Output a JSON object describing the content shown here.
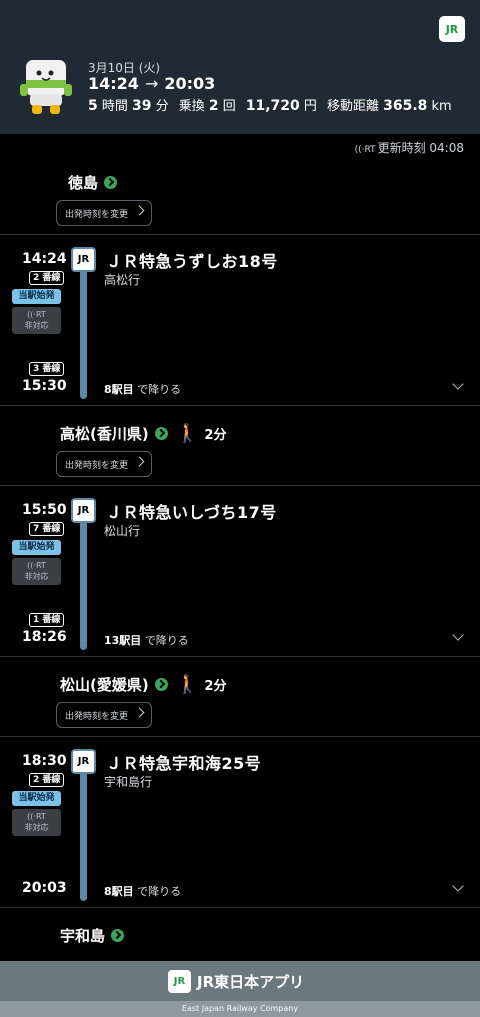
{
  "header": {
    "app_logo": "JR",
    "date": "3月10日 (火)",
    "depart": "14:24",
    "arrow": "→",
    "arrive": "20:03",
    "duration_h": "5",
    "duration_h_unit": "時間",
    "duration_m": "39",
    "duration_m_unit": "分",
    "transfer_label": "乗換",
    "transfers": "2",
    "transfer_unit": "回",
    "fare": "11,720",
    "fare_unit": "円",
    "distance_label": "移動距離",
    "distance": "365.8",
    "distance_unit": "km"
  },
  "realtime": {
    "icon": "((·RT",
    "label": "更新時刻",
    "time": "04:08"
  },
  "stations": {
    "s1": "徳島",
    "s2": "高松(香川県)",
    "s3": "松山(愛媛県)",
    "s4": "宇和島"
  },
  "change_departure_label": "出発時刻を変更",
  "walks": {
    "w1": "2分",
    "w2": "2分"
  },
  "legs": [
    {
      "dep_time": "14:24",
      "dep_track": "2 番線",
      "origin_badge": "当駅始発",
      "rt_badge_1": "((·RT",
      "rt_badge_2": "非対応",
      "logo": "JR",
      "train_name": "ＪＲ特急うずしお18号",
      "destination": "高松行",
      "arr_track": "3 番線",
      "arr_time": "15:30",
      "stops_count": "8駅目",
      "stops_suffix": "で降りる"
    },
    {
      "dep_time": "15:50",
      "dep_track": "7 番線",
      "origin_badge": "当駅始発",
      "rt_badge_1": "((·RT",
      "rt_badge_2": "非対応",
      "logo": "JR",
      "train_name": "ＪＲ特急いしづち17号",
      "destination": "松山行",
      "arr_track": "1 番線",
      "arr_time": "18:26",
      "stops_count": "13駅目",
      "stops_suffix": "で降りる"
    },
    {
      "dep_time": "18:30",
      "dep_track": "2 番線",
      "origin_badge": "当駅始発",
      "rt_badge_1": "((·RT",
      "rt_badge_2": "非対応",
      "logo": "JR",
      "train_name": "ＪＲ特急宇和海25号",
      "destination": "宇和島行",
      "arr_track": "",
      "arr_time": "20:03",
      "stops_count": "8駅目",
      "stops_suffix": "で降りる"
    }
  ],
  "footer": {
    "logo": "JR",
    "title": "JR東日本アプリ",
    "subtitle": "East Japan Railway Company"
  },
  "colors": {
    "header_bg": "#1f2a35",
    "accent_green": "#3ba55c",
    "line_blue": "#5a8aa8",
    "origin_badge": "#7cc1e8"
  }
}
